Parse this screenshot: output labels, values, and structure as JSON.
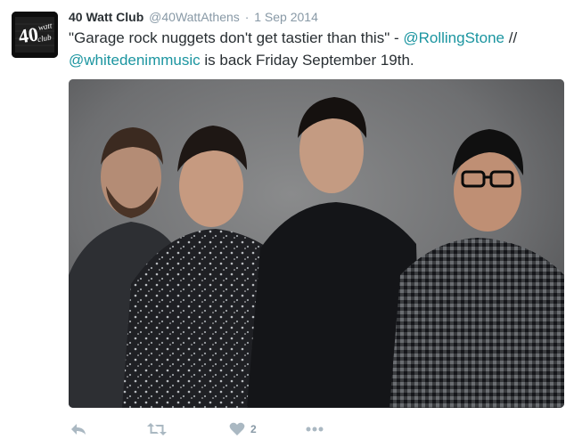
{
  "tweet": {
    "display_name": "40 Watt Club",
    "handle": "@40WattAthens",
    "separator": "·",
    "date": "1 Sep 2014",
    "text_part1": "\"Garage rock nuggets don't get tastier than this\" - ",
    "mention1": "@RollingStone",
    "text_part2": " //",
    "mention2": "@whitedenimmusic",
    "text_part3": " is back Friday September 19th.",
    "avatar": {
      "line1": "40",
      "line2": "watt",
      "line3": "club"
    },
    "media": {
      "description_icon": "band-photo"
    }
  },
  "actions": {
    "reply_icon": "reply-icon",
    "retweet_icon": "retweet-icon",
    "like_icon": "heart-icon",
    "like_count": "2",
    "more_icon": "more-icon"
  },
  "colors": {
    "link": "#1b95a0",
    "meta": "#8899a6",
    "text": "#292f33"
  }
}
